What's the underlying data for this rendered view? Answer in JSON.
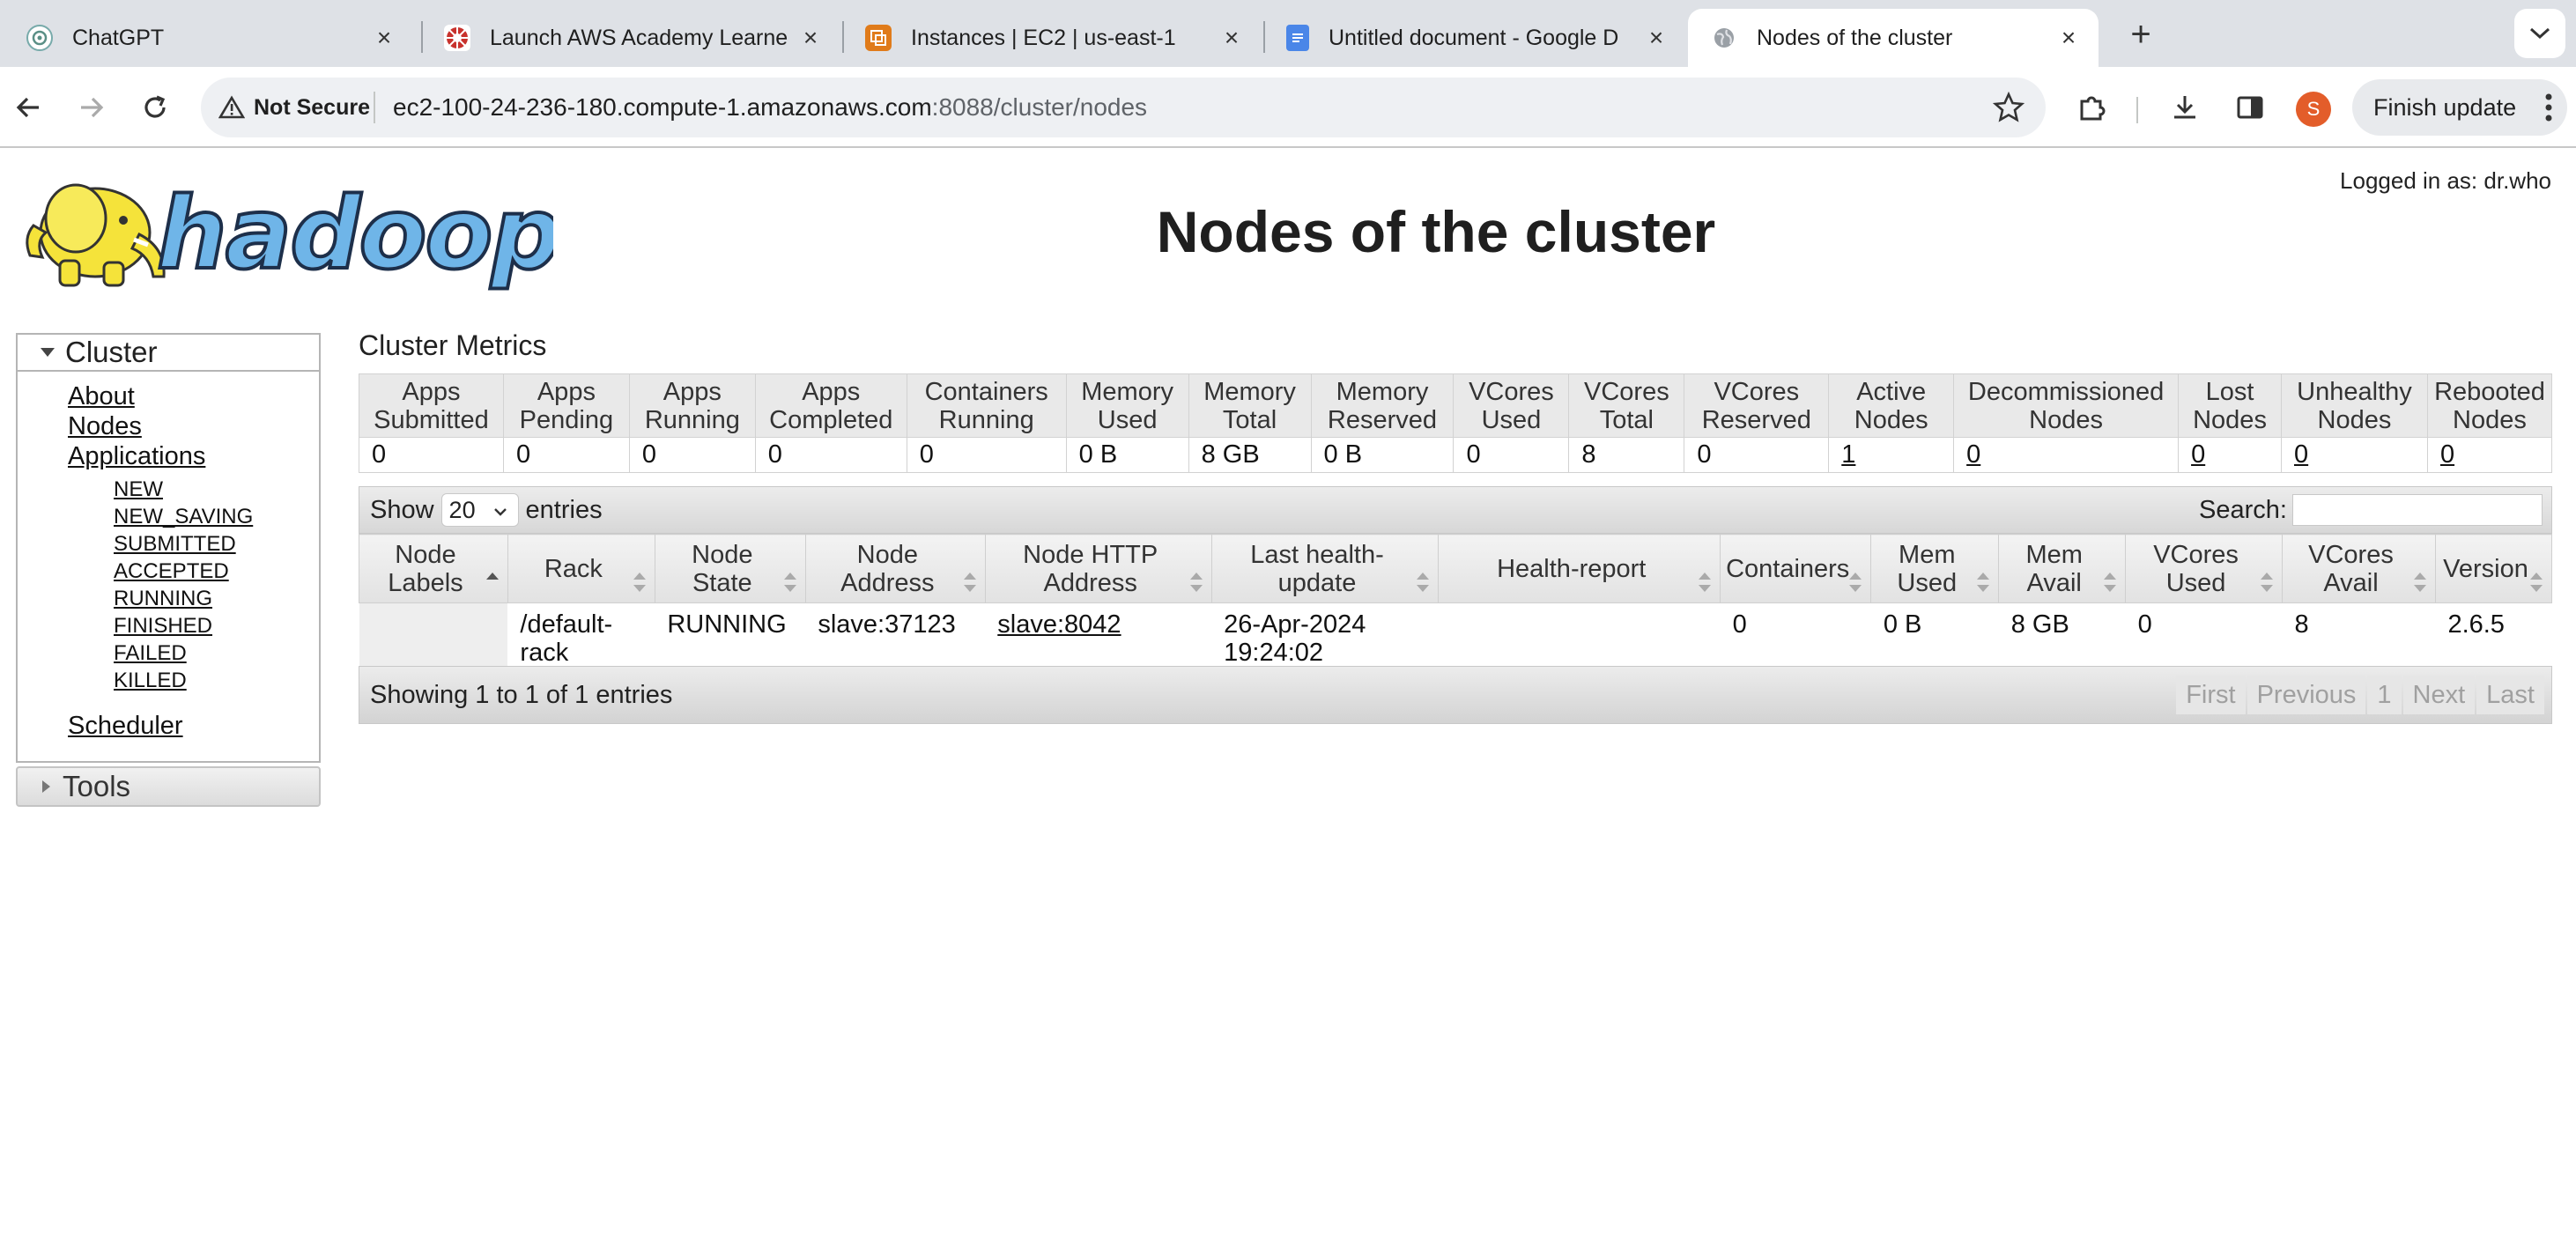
{
  "browser": {
    "tabs": [
      {
        "title": "ChatGPT",
        "icon": "chatgpt-icon"
      },
      {
        "title": "Launch AWS Academy Learne",
        "icon": "aws-academy-icon"
      },
      {
        "title": "Instances | EC2 | us-east-1",
        "icon": "ec2-icon"
      },
      {
        "title": "Untitled document - Google D",
        "icon": "google-docs-icon"
      },
      {
        "title": "Nodes of the cluster",
        "icon": "globe-icon"
      }
    ],
    "security_label": "Not Secure",
    "url_host": "ec2-100-24-236-180.compute-1.amazonaws.com",
    "url_path": ":8088/cluster/nodes",
    "profile_initial": "S",
    "finish_update_label": "Finish update"
  },
  "page": {
    "title": "Nodes of the cluster",
    "logged_in": "Logged in as: dr.who"
  },
  "sidebar": {
    "cluster_label": "Cluster",
    "links": [
      "About",
      "Nodes",
      "Applications"
    ],
    "app_states": [
      "NEW",
      "NEW_SAVING",
      "SUBMITTED",
      "ACCEPTED",
      "RUNNING",
      "FINISHED",
      "FAILED",
      "KILLED"
    ],
    "scheduler_label": "Scheduler",
    "tools_label": "Tools"
  },
  "metrics": {
    "title": "Cluster Metrics",
    "headers": [
      [
        "Apps",
        "Submitted"
      ],
      [
        "Apps",
        "Pending"
      ],
      [
        "Apps",
        "Running"
      ],
      [
        "Apps",
        "Completed"
      ],
      [
        "Containers",
        "Running"
      ],
      [
        "Memory",
        "Used"
      ],
      [
        "Memory",
        "Total"
      ],
      [
        "Memory",
        "Reserved"
      ],
      [
        "VCores",
        "Used"
      ],
      [
        "VCores",
        "Total"
      ],
      [
        "VCores",
        "Reserved"
      ],
      [
        "Active",
        "Nodes"
      ],
      [
        "Decommissioned",
        "Nodes"
      ],
      [
        "Lost",
        "Nodes"
      ],
      [
        "Unhealthy",
        "Nodes"
      ],
      [
        "Rebooted",
        "Nodes"
      ]
    ],
    "values": [
      "0",
      "0",
      "0",
      "0",
      "0",
      "0 B",
      "8 GB",
      "0 B",
      "0",
      "8",
      "0",
      "1",
      "0",
      "0",
      "0",
      "0"
    ]
  },
  "datatable": {
    "show_label": "Show",
    "page_length": "20",
    "entries_label": "entries",
    "search_label": "Search:",
    "search_value": "",
    "headers": [
      [
        "Node",
        "Labels"
      ],
      [
        "Rack"
      ],
      [
        "Node",
        "State"
      ],
      [
        "Node",
        "Address"
      ],
      [
        "Node HTTP",
        "Address"
      ],
      [
        "Last health-",
        "update"
      ],
      [
        "Health-report"
      ],
      [
        "Containers"
      ],
      [
        "Mem",
        "Used"
      ],
      [
        "Mem",
        "Avail"
      ],
      [
        "VCores",
        "Used"
      ],
      [
        "VCores",
        "Avail"
      ],
      [
        "Version"
      ]
    ],
    "rows": [
      {
        "node_labels": "",
        "rack": [
          "/default-",
          "rack"
        ],
        "node_state": "RUNNING",
        "node_address": "slave:37123",
        "node_http_address": "slave:8042",
        "last_health_update": [
          "26-Apr-2024",
          "19:24:02"
        ],
        "health_report": "",
        "containers": "0",
        "mem_used": "0 B",
        "mem_avail": "8 GB",
        "vcores_used": "0",
        "vcores_avail": "8",
        "version": "2.6.5"
      }
    ],
    "info": "Showing 1 to 1 of 1 entries",
    "pager": [
      "First",
      "Previous",
      "1",
      "Next",
      "Last"
    ]
  },
  "colors": {
    "tabbar_bg": "#dee1e6",
    "header_bg": "#e9e9e9",
    "profile": "#e35d2a",
    "logo_yellow": "#f5e33a",
    "logo_blue": "#6fb5e8"
  }
}
